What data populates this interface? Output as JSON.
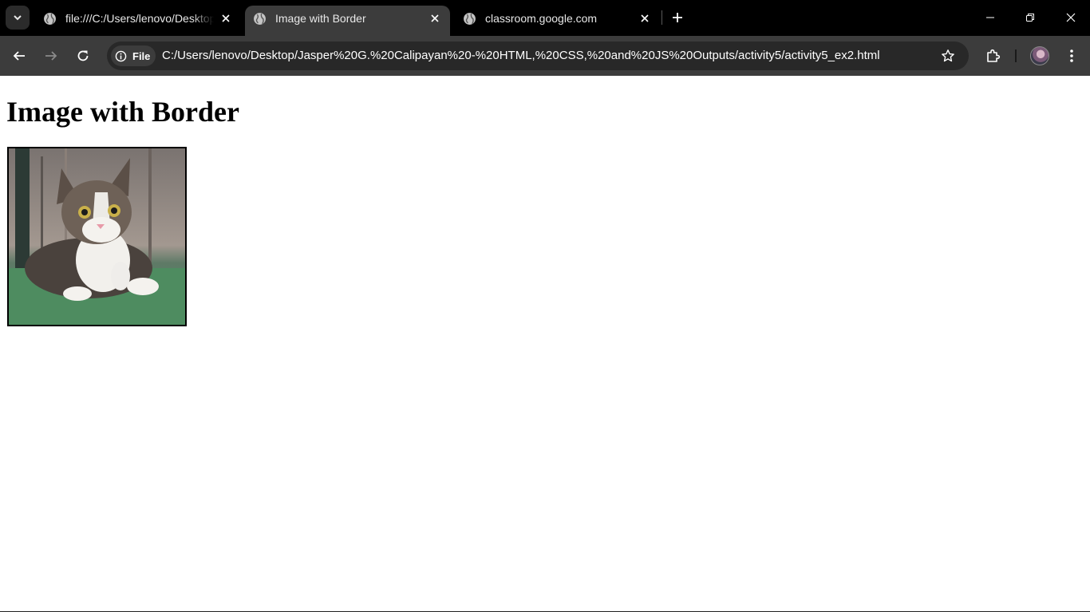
{
  "browser": {
    "tabs": [
      {
        "title": "file:///C:/Users/lenovo/Desktop/",
        "active": false,
        "favicon": "globe-icon"
      },
      {
        "title": "Image with Border",
        "active": true,
        "favicon": "globe-icon"
      },
      {
        "title": "classroom.google.com",
        "active": false,
        "favicon": "globe-icon"
      }
    ],
    "site_chip_label": "File",
    "url": "C:/Users/lenovo/Desktop/Jasper%20G.%20Calipayan%20-%20HTML,%20CSS,%20and%20JS%20Outputs/activity5/activity5_ex2.html"
  },
  "page": {
    "heading": "Image with Border",
    "image": {
      "subject": "kitten sitting on grass",
      "border_color": "#000000"
    }
  },
  "colors": {
    "tabstrip": "#000000",
    "toolbar": "#3c3c3c",
    "omnibox": "#282828",
    "active_tab": "#3c3c3c"
  }
}
